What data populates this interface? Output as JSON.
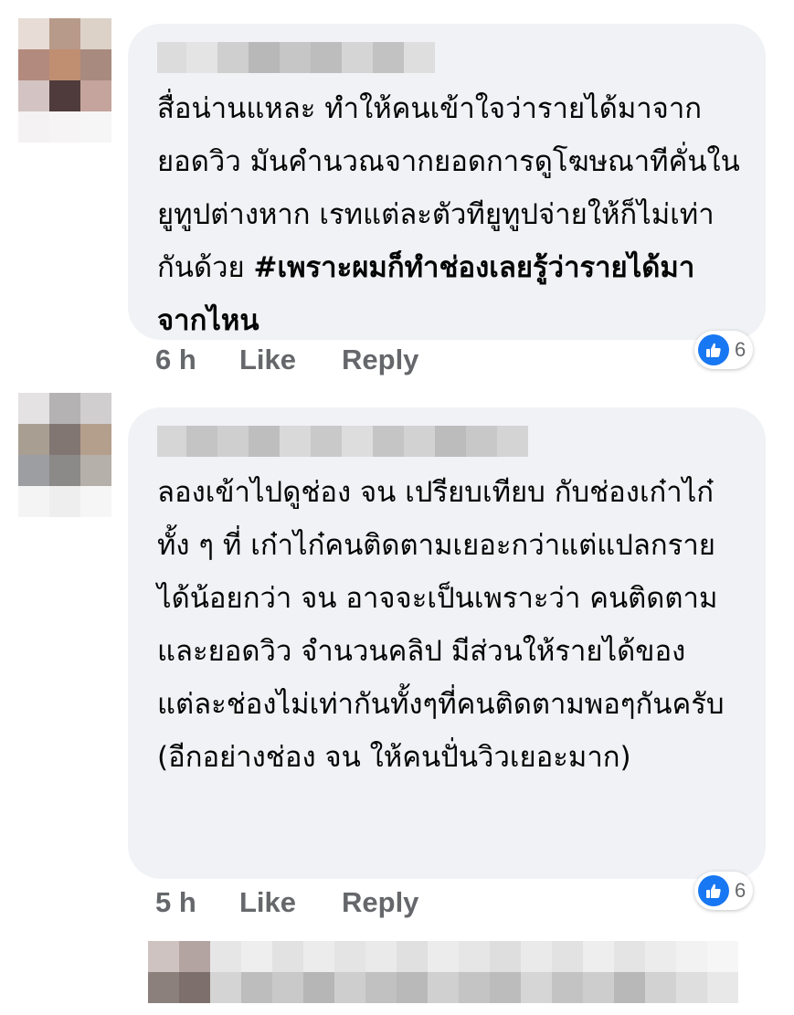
{
  "comments": [
    {
      "text": "สื่อน่านแหละ ทำให้คนเข้าใจว่ารายได้มาจากยอดวิว มันคำนวณจากยอดการดูโฆษณาทีคั่นในยูทูปต่างหาก เรทแต่ละตัวทียูทูปจ่ายให้ก็ไม่เท่ากันด้วย ",
      "hashtag": "#เพราะผมก็ทำช่องเลยรู้ว่ารายได้มาจากไหน",
      "time": "6 h",
      "like_label": "Like",
      "reply_label": "Reply",
      "reaction_count": "6"
    },
    {
      "text": "ลองเข้าไปดูช่อง จน เปรียบเทียบ กับช่องเก๋าไก๋ ทั้ง ๆ ที่ เก๋าไก๋คนติดตามเยอะกว่าแต่แปลกรายได้น้อยกว่า จน อาจจะเป็นเพราะว่า คนติดตาม และยอดวิว จำนวนคลิป มีส่วนให้รายได้ของแต่ละช่องไม่เท่ากันทั้งๆที่คนติดตามพอๆกันครับ (อีกอย่างช่อง จน ให้คนปั่นวิวเยอะมาก)",
      "time": "5 h",
      "like_label": "Like",
      "reply_label": "Reply",
      "reaction_count": "6"
    }
  ],
  "colors": {
    "bubble": "#f0f2f5",
    "meta_text": "#65676b",
    "like_blue": "#1877f2"
  }
}
